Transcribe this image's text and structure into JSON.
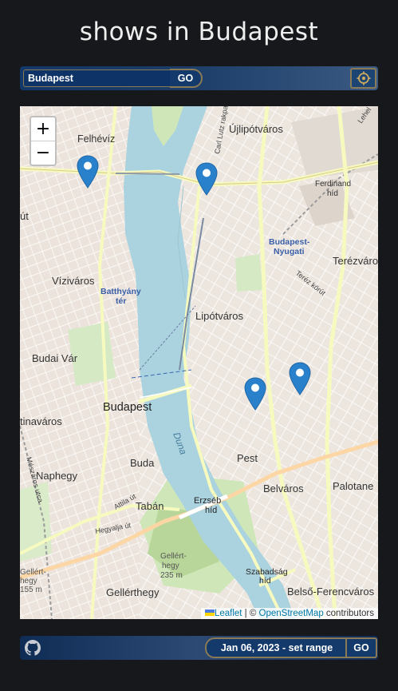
{
  "page": {
    "title": "shows in Budapest"
  },
  "search": {
    "value": "Budapest",
    "go_label": "GO",
    "locate_icon": "crosshair-icon"
  },
  "map": {
    "zoom_in": "+",
    "zoom_out": "−",
    "labels": {
      "felheviz": "Felhévíz",
      "ujlipotvaros": "Újlipótváros",
      "ferdinand": "Ferdinand",
      "hid1": "híd",
      "nyugati1": "Budapest-",
      "nyugati2": "Nyugati",
      "terezvaros": "Terézváros",
      "vizivaros": "Víziváros",
      "batthyany1": "Batthyány",
      "batthyany2": "tér",
      "lipotvaros": "Lipótváros",
      "budai_var": "Budai Vár",
      "budapest": "Budapest",
      "duna": "Duna",
      "tinavaros": "tinaváros",
      "naphegy": "Naphegy",
      "buda": "Buda",
      "taban": "Tabán",
      "erzsebet1": "Erzséb",
      "erzsebet2": "híd",
      "pest": "Pest",
      "belvaros": "Belváros",
      "palotanegyed": "Palotane",
      "gellerthegy": "Gellérthegy",
      "gellert_peak1": "Gellért-",
      "gellert_peak2": "hegy",
      "gellert_peak3": "235 m",
      "szabadsag1": "Szabadság",
      "szabadsag2": "híd",
      "belso_ferencvaros": "Belső-Ferencváros",
      "utca_left": "Gellért-",
      "utca_left2": "hegy",
      "utca_left3": "155 m",
      "street_carl": "Carl Lutz rakpart",
      "street_attila": "Attila út",
      "street_hegyalja": "Hegyalja út",
      "street_meszaros": "Mészáros utca",
      "street_lehel": "Lehel",
      "street_terez": "Teréz körút",
      "ut_left": "út"
    },
    "markers": [
      {
        "name": "show-marker"
      },
      {
        "name": "show-marker"
      },
      {
        "name": "show-marker"
      },
      {
        "name": "show-marker"
      }
    ],
    "attribution": {
      "leaflet": "Leaflet",
      "sep": " | © ",
      "osm": "OpenStreetMap",
      "contributors": " contributors"
    }
  },
  "footer": {
    "github_icon": "github-icon",
    "date_range": "Jan 06, 2023 - set range",
    "go_label": "GO"
  }
}
